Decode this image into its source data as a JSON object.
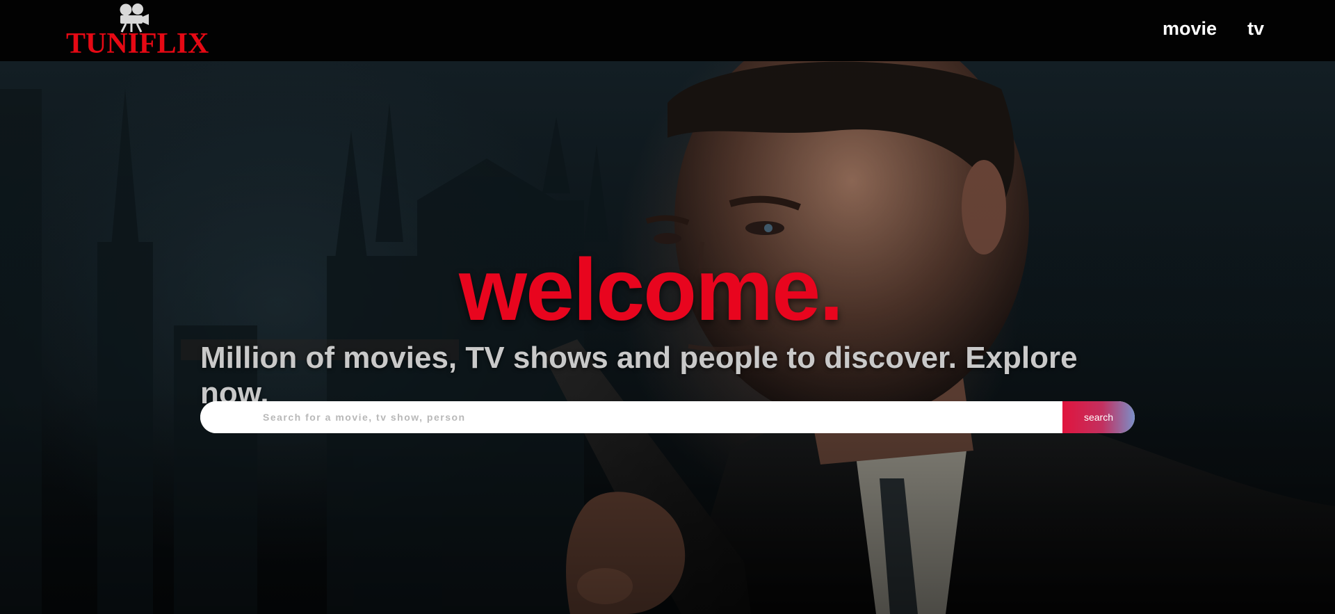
{
  "header": {
    "logo_text": "TUNIFLIX",
    "nav": [
      {
        "label": "movie"
      },
      {
        "label": "tv"
      }
    ]
  },
  "hero": {
    "title": "welcome.",
    "subtitle": "Million of movies, TV shows and people to discover. Explore now.",
    "search": {
      "placeholder": "Search for a movie, tv show, person",
      "value": "",
      "button_label": "search"
    }
  },
  "colors": {
    "brand_red": "#e50914",
    "header_bg": "#020202",
    "search_button_gradient": [
      "#e0153e",
      "#7b8fc8"
    ]
  },
  "icons": {
    "logo_icon": "movie-camera-icon"
  }
}
